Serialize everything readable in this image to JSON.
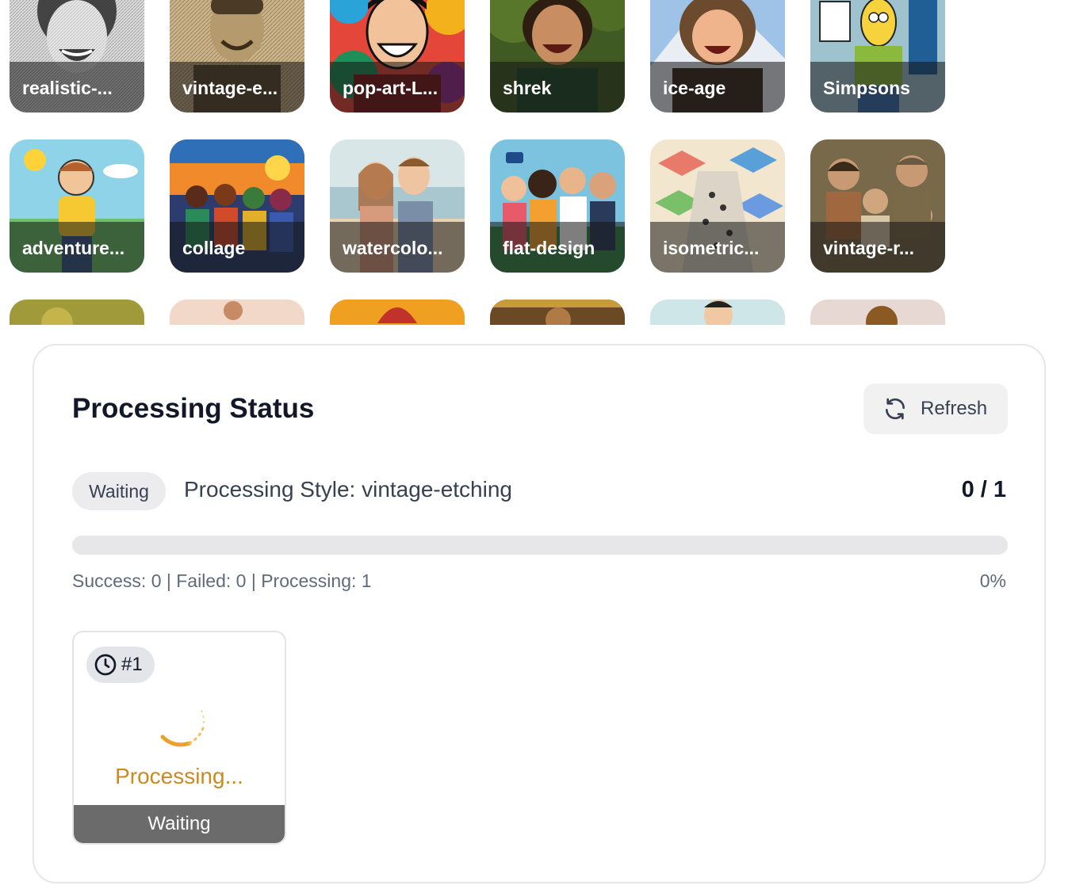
{
  "gallery": {
    "rows": [
      [
        {
          "label": "realistic-..."
        },
        {
          "label": "vintage-e..."
        },
        {
          "label": "pop-art-L..."
        },
        {
          "label": "shrek"
        },
        {
          "label": "ice-age"
        },
        {
          "label": "Simpsons"
        }
      ],
      [
        {
          "label": "adventure..."
        },
        {
          "label": "collage"
        },
        {
          "label": "watercolo..."
        },
        {
          "label": "flat-design"
        },
        {
          "label": "isometric..."
        },
        {
          "label": "vintage-r..."
        }
      ]
    ]
  },
  "status": {
    "title": "Processing Status",
    "refresh_label": "Refresh",
    "state_pill": "Waiting",
    "job_title": "Processing Style: vintage-etching",
    "count": "0 / 1",
    "progress_fraction": 0,
    "stats": "Success: 0 | Failed: 0 | Processing: 1",
    "percent": "0%"
  },
  "items": [
    {
      "number": "#1",
      "state": "Processing...",
      "footer": "Waiting"
    }
  ],
  "colors": {
    "accent": "#d99a26",
    "processing_text": "#c98a1e",
    "footer_bg": "#6b6b6b"
  },
  "icons": {
    "refresh": "refresh-icon",
    "clock": "clock-icon",
    "spinner": "loading-spinner-icon"
  }
}
